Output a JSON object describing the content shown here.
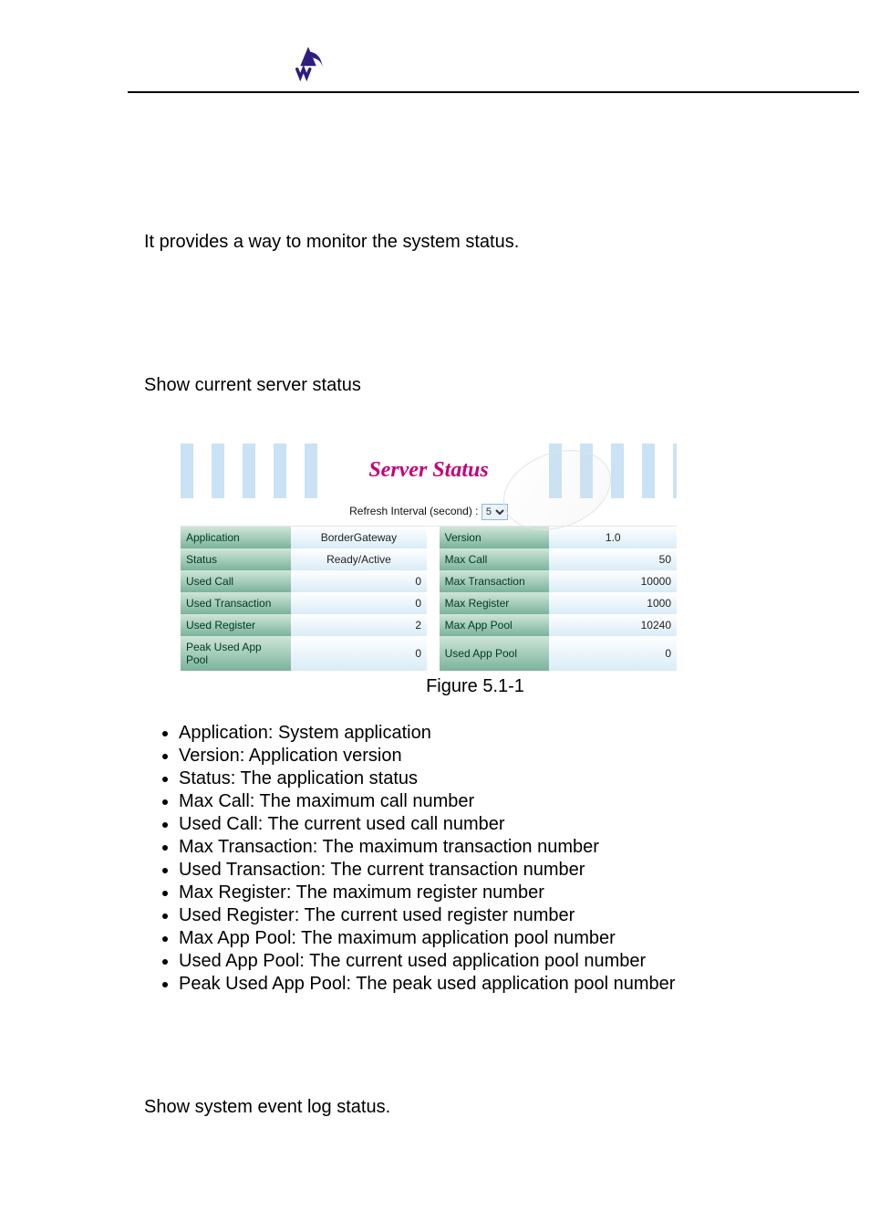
{
  "intro_text": "It provides a way to monitor the system status.",
  "subheading": "Show current server status",
  "panel": {
    "title": "Server Status",
    "refresh_label": "Refresh Interval (second) :",
    "refresh_value": "5"
  },
  "status_rows": [
    {
      "l1": "Application",
      "v1": "BorderGateway",
      "l2": "Version",
      "v2": "1.0",
      "v1_align": "center",
      "v2_align": "center"
    },
    {
      "l1": "Status",
      "v1": "Ready/Active",
      "l2": "Max Call",
      "v2": "50",
      "v1_align": "center"
    },
    {
      "l1": "Used Call",
      "v1": "0",
      "l2": "Max Transaction",
      "v2": "10000"
    },
    {
      "l1": "Used Transaction",
      "v1": "0",
      "l2": "Max Register",
      "v2": "1000"
    },
    {
      "l1": "Used Register",
      "v1": "2",
      "l2": "Max App Pool",
      "v2": "10240"
    },
    {
      "l1": "Peak Used App Pool",
      "v1": "0",
      "l2": "Used App Pool",
      "v2": "0"
    }
  ],
  "figure_caption": "Figure 5.1-1",
  "definitions": [
    "Application: System application",
    "Version: Application version",
    "Status: The application status",
    "Max Call: The maximum call number",
    "Used Call: The current used call number",
    "Max Transaction: The maximum transaction number",
    "Used Transaction: The current transaction number",
    "Max Register: The maximum register number",
    "Used Register: The current used register number",
    "Max App Pool: The maximum application pool number",
    "Used App Pool: The current used application pool number",
    "Peak Used App Pool: The peak used application pool number"
  ],
  "event_log_text": "Show system event log status."
}
